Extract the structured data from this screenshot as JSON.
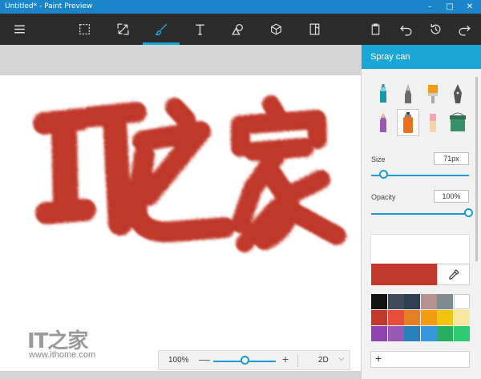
{
  "window": {
    "title": "Untitled* - Paint Preview",
    "minimize": "–",
    "maximize": "□",
    "close": "✕"
  },
  "toolbar": {
    "tools": [
      {
        "name": "menu-icon"
      },
      {
        "name": "select-icon"
      },
      {
        "name": "crop-icon"
      },
      {
        "name": "brush-icon",
        "active": true
      },
      {
        "name": "text-icon"
      },
      {
        "name": "shapes-2d-icon"
      },
      {
        "name": "3d-object-icon"
      },
      {
        "name": "stickers-icon"
      }
    ],
    "right": [
      {
        "name": "paste-icon"
      },
      {
        "name": "undo-icon"
      },
      {
        "name": "history-icon"
      },
      {
        "name": "redo-icon"
      }
    ],
    "accent": "#1aa7d8"
  },
  "canvas": {
    "text": "IT之家",
    "paint_color": "#c0392b"
  },
  "zoom": {
    "value": "100%",
    "minus": "—",
    "plus": "+",
    "mode": "2D",
    "level": 0.5
  },
  "watermark": {
    "logo": "IT之家",
    "url": "www.ithome.com"
  },
  "panel": {
    "title": "Spray can",
    "brushes": [
      "marker",
      "calligraphy-pen",
      "oil-brush",
      "ink-pen",
      "pencil",
      "spray-can",
      "eraser",
      "fill-bucket"
    ],
    "selected_brush": "spray-can",
    "size_label": "Size",
    "size_value": "71px",
    "size_level": 0.12,
    "opacity_label": "Opacity",
    "opacity_value": "100%",
    "opacity_level": 1.0,
    "current_color": "#c0392b",
    "palette": [
      "#111111",
      "#3e4b5b",
      "#2c3e50",
      "#b3918f",
      "#7f8c8d",
      "#ffffff",
      "#c0392b",
      "#e74c3c",
      "#e67e22",
      "#f39c12",
      "#f1c40f",
      "#f9e79f",
      "#8e44ad",
      "#9b59b6",
      "#2980b9",
      "#3498db",
      "#27ae60",
      "#2ecc71"
    ],
    "add_label": "+"
  }
}
